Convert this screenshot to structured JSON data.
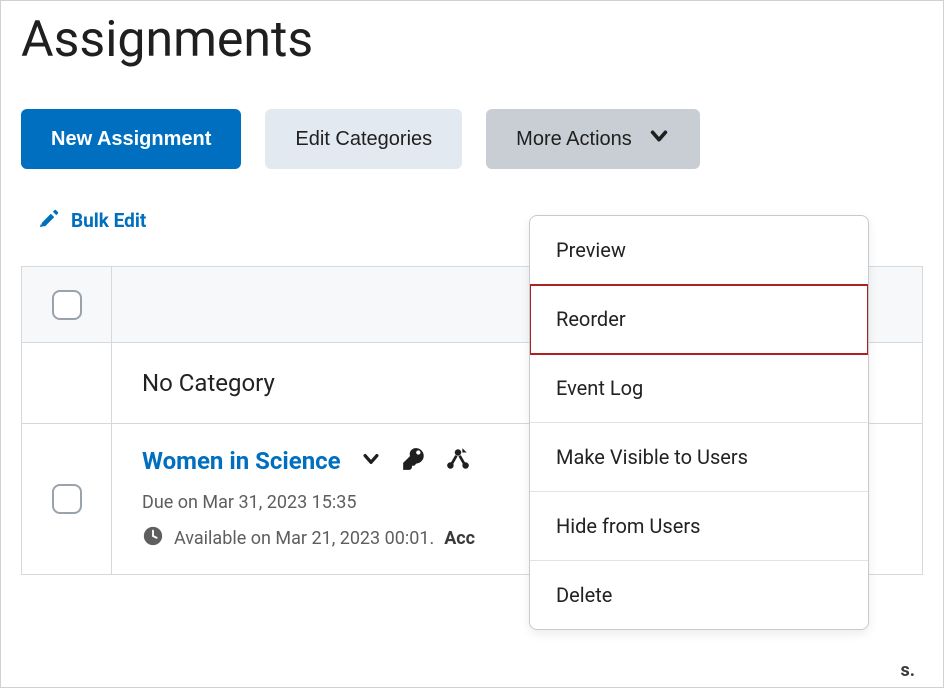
{
  "page": {
    "title": "Assignments"
  },
  "toolbar": {
    "new_assignment": "New Assignment",
    "edit_categories": "Edit Categories",
    "more_actions": "More Actions"
  },
  "bulk_edit": {
    "label": "Bulk Edit"
  },
  "table": {
    "category_label": "No Category",
    "assignment": {
      "title": "Women in Science",
      "due": "Due on Mar 31, 2023 15:35",
      "available_prefix": "Available on Mar 21, 2023 00:01.",
      "acc_prefix": "Acc",
      "truncated_suffix": "s."
    }
  },
  "menu": {
    "items": [
      "Preview",
      "Reorder",
      "Event Log",
      "Make Visible to Users",
      "Hide from Users",
      "Delete"
    ],
    "highlighted_index": 1
  }
}
